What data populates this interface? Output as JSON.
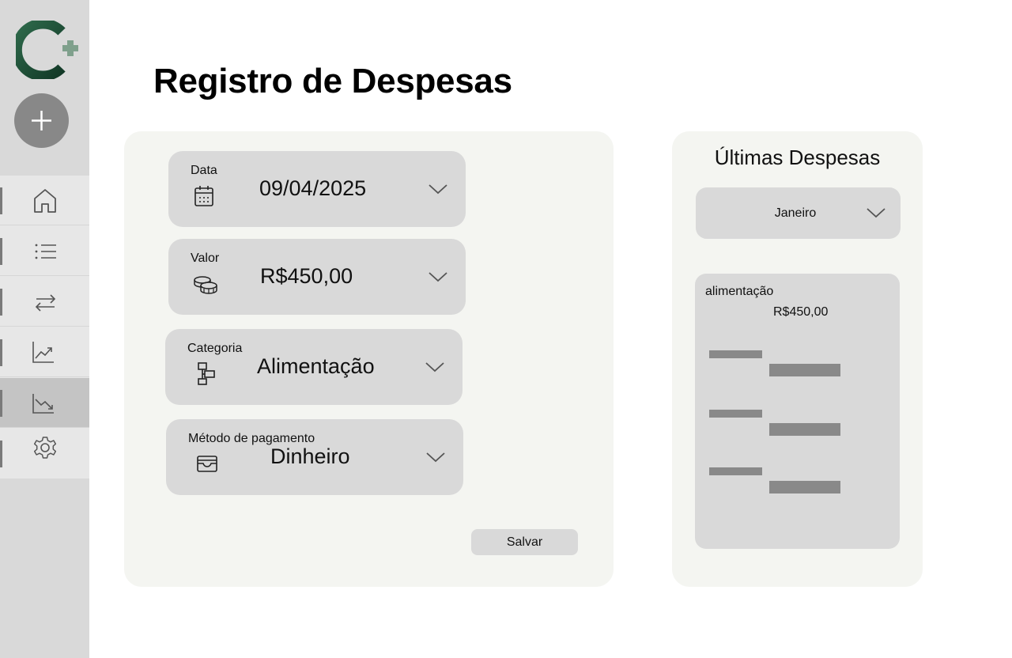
{
  "page": {
    "title": "Registro de Despesas"
  },
  "sidebar": {
    "logo": "c-plus-logo",
    "add_icon": "plus-icon",
    "items": [
      {
        "icon": "home-icon",
        "active": false
      },
      {
        "icon": "list-icon",
        "active": false
      },
      {
        "icon": "transfer-icon",
        "active": false
      },
      {
        "icon": "trending-up-icon",
        "active": false
      },
      {
        "icon": "trending-down-icon",
        "active": true
      },
      {
        "icon": "settings-icon",
        "active": false
      }
    ]
  },
  "form": {
    "date": {
      "label": "Data",
      "value": "09/04/2025",
      "icon": "calendar-icon"
    },
    "amount": {
      "label": "Valor",
      "value": "R$450,00",
      "icon": "coins-icon"
    },
    "category": {
      "label": "Categoria",
      "value": "Alimentação",
      "icon": "category-icon"
    },
    "payment": {
      "label": "Método de pagamento",
      "value": "Dinheiro",
      "icon": "wallet-icon"
    },
    "save_label": "Salvar"
  },
  "recent": {
    "title": "Últimas Despesas",
    "month": "Janeiro",
    "latest": {
      "category": "alimentação",
      "amount": "R$450,00"
    }
  },
  "colors": {
    "sidebar": "#d9d9d9",
    "panel": "#f4f5f1",
    "field": "#d9d9d9",
    "placeholder": "#898989",
    "logo_dark": "#1e4d37",
    "logo_light": "#7fa08c"
  }
}
